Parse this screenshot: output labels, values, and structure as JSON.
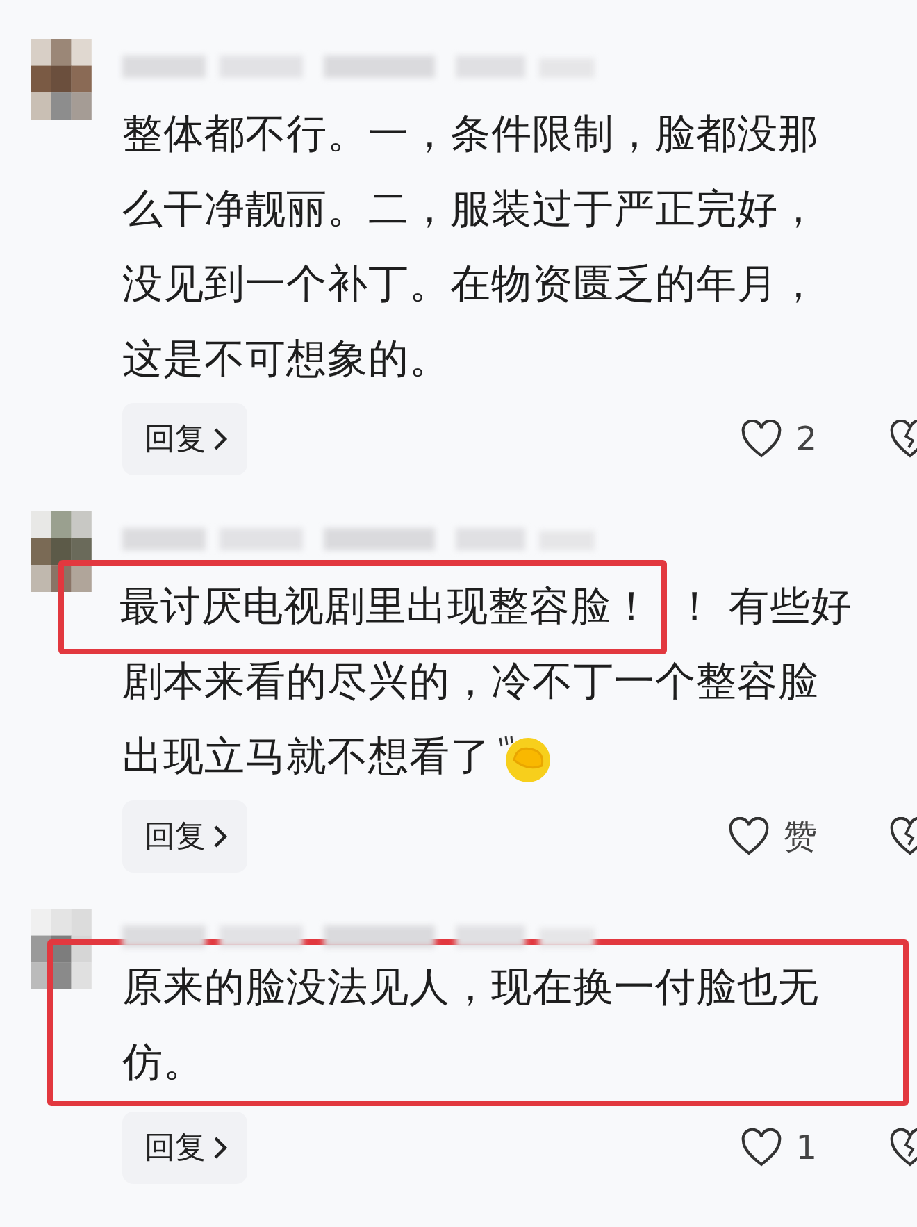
{
  "comments": [
    {
      "boxed": false,
      "lines": [
        [
          {
            "text": "整体都不行。一，条件限制，脸都没那",
            "highlighted": false
          }
        ],
        [
          {
            "text": "么干净靓丽。二，服装过于严正完好，",
            "highlighted": false
          }
        ],
        [
          {
            "text": "没见到一个补丁。在物资匮乏的年月，",
            "highlighted": false
          }
        ],
        [
          {
            "text": "这是不可想象的。",
            "highlighted": false
          }
        ]
      ],
      "emoji": false,
      "reply": "回复",
      "likes": "2"
    },
    {
      "boxed": false,
      "lines": [
        [
          {
            "text": "最讨厌电视剧里出现整容脸！",
            "highlighted": true
          },
          {
            "text": "！ 有些好",
            "highlighted": false
          }
        ],
        [
          {
            "text": "剧本来看的尽兴的，冷不丁一个整容脸",
            "highlighted": false
          }
        ],
        [
          {
            "text": "出现立马就不想看了",
            "highlighted": false
          }
        ]
      ],
      "emoji": true,
      "reply": "回复",
      "likes": "赞"
    },
    {
      "boxed": true,
      "lines": [
        [
          {
            "text": "原来的脸没法见人，现在换一付脸也无",
            "highlighted": false
          }
        ],
        [
          {
            "text": "仿。",
            "highlighted": false
          }
        ]
      ],
      "emoji": false,
      "reply": "回复",
      "likes": "1"
    }
  ]
}
